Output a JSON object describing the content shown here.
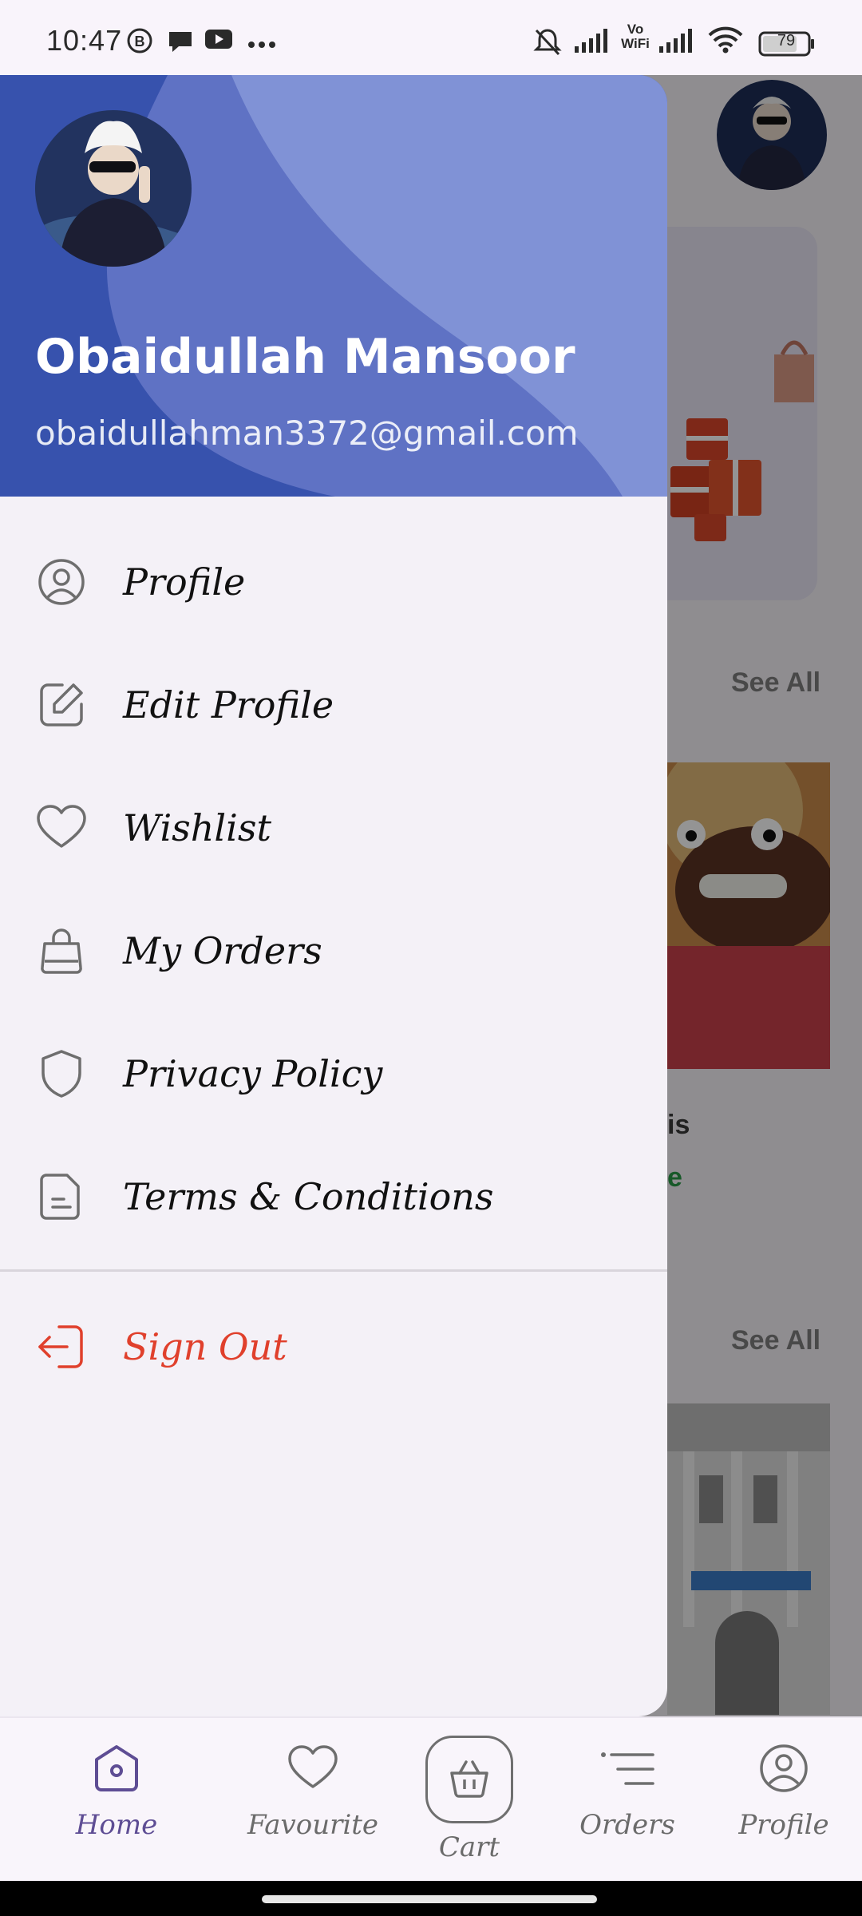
{
  "status_bar": {
    "time": "10:47",
    "battery": "79",
    "wifi_label_top": "Vo",
    "wifi_label_bottom": "WiFi",
    "icons": [
      "b-icon",
      "chat-bubble-icon",
      "youtube-icon",
      "more-dots-icon",
      "bell-muted-icon",
      "signal-icon",
      "vowifi-icon",
      "signal-icon",
      "wifi-icon",
      "battery-icon"
    ]
  },
  "background_page": {
    "see_all_1": "See All",
    "see_all_2": "See All",
    "product_title_fragment": "is",
    "product_price_fragment": "e"
  },
  "drawer": {
    "user_name": "Obaidullah Mansoor",
    "user_email": "obaidullahman3372@gmail.com",
    "menu": [
      {
        "label": "Profile",
        "icon": "user-circle-icon"
      },
      {
        "label": "Edit Profile",
        "icon": "edit-square-icon"
      },
      {
        "label": "Wishlist",
        "icon": "heart-icon"
      },
      {
        "label": "My Orders",
        "icon": "shopping-bag-icon"
      },
      {
        "label": "Privacy Policy",
        "icon": "shield-icon"
      },
      {
        "label": "Terms & Conditions",
        "icon": "document-icon"
      }
    ],
    "sign_out": {
      "label": "Sign Out",
      "icon": "logout-icon",
      "color": "#e0402c"
    }
  },
  "bottom_nav": {
    "items": [
      {
        "label": "Home",
        "icon": "home-icon",
        "active": true
      },
      {
        "label": "Favourite",
        "icon": "heart-icon"
      },
      {
        "label": "Cart",
        "icon": "basket-icon"
      },
      {
        "label": "Orders",
        "icon": "list-icon"
      },
      {
        "label": "Profile",
        "icon": "user-circle-icon"
      }
    ]
  },
  "colors": {
    "header_blue": "#3b57b3",
    "accent_purple": "#5e4d94",
    "sign_out_red": "#e0402c"
  }
}
